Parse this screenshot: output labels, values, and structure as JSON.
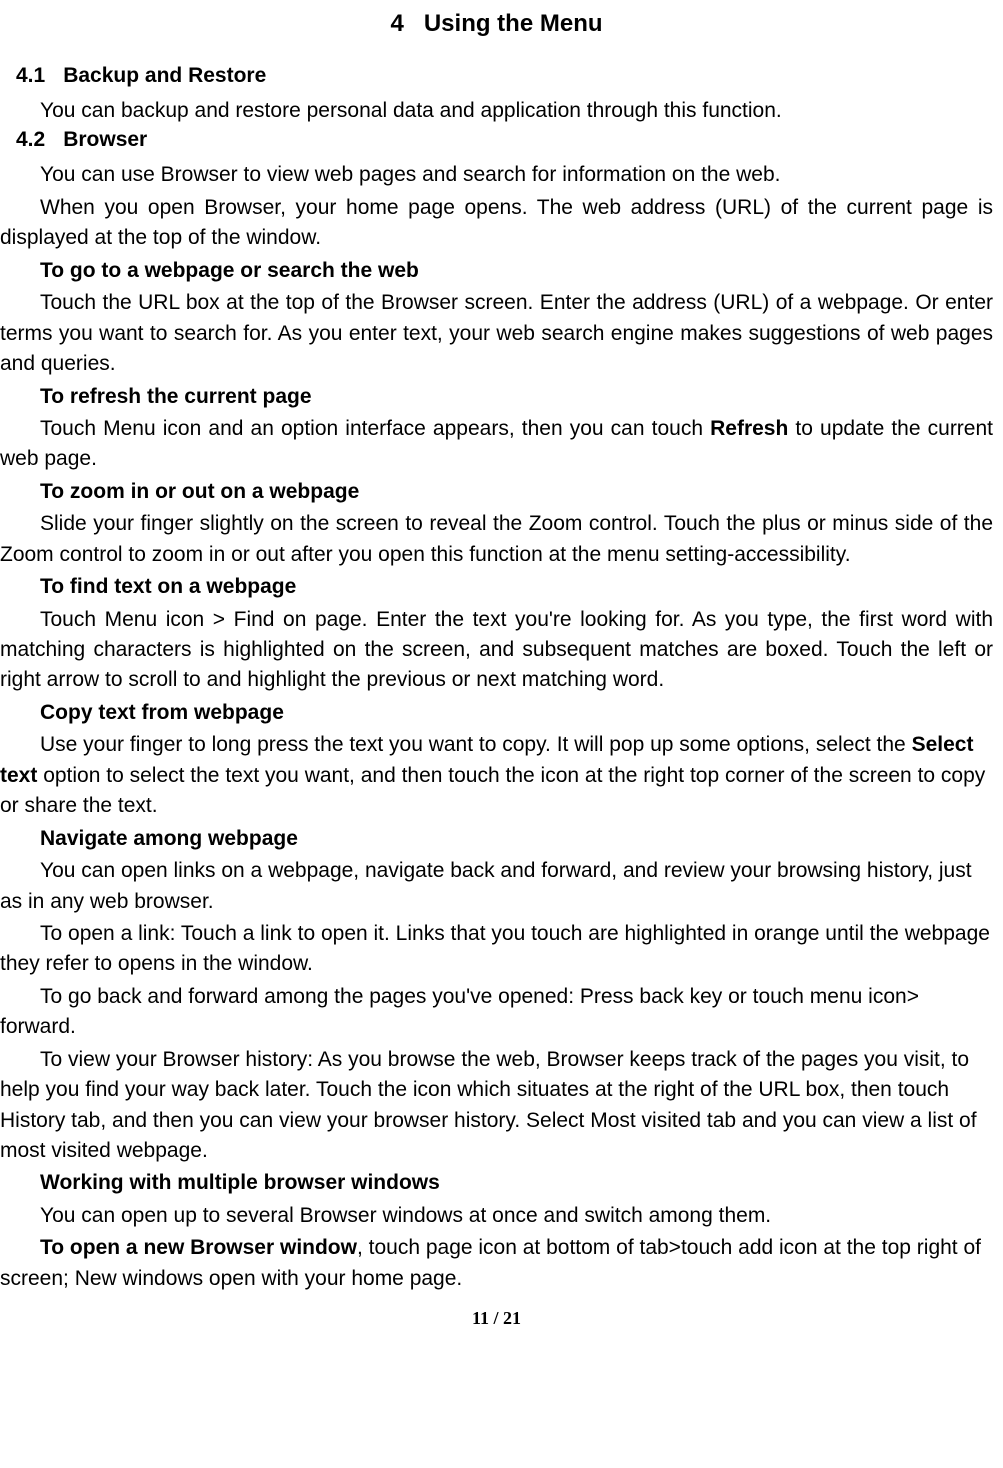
{
  "chapter": {
    "number": "4",
    "title": "Using the Menu"
  },
  "sections": {
    "s41": {
      "number": "4.1",
      "title": "Backup and Restore"
    },
    "s42": {
      "number": "4.2",
      "title": "Browser"
    }
  },
  "body": {
    "backup_para": "You can backup and restore personal data and application through this function.",
    "browser_intro": "You can use Browser to view web pages and search for information on the web.",
    "browser_open": "When you open Browser, your home page opens. The web address (URL) of the current page is displayed at the top of the window.",
    "goto_head": "To go to a webpage or search the web",
    "goto_body": "Touch the URL box at the top of the Browser screen. Enter the address (URL) of a webpage. Or enter terms you want to search for. As you enter text, your web search engine makes suggestions of web pages and queries.",
    "refresh_head": "To refresh the current page",
    "refresh_body_pre": "Touch Menu icon and an option interface appears, then you can touch ",
    "refresh_bold": "Refresh",
    "refresh_body_post": " to update the current web page.",
    "zoom_head": "To zoom in or out on a webpage",
    "zoom_body": "Slide your finger slightly on the screen to reveal the Zoom control. Touch the plus or minus side of the Zoom control to zoom in or out after you open this function at the menu setting-accessibility.",
    "find_head": "To find text on a webpage",
    "find_body": "Touch Menu icon > Find on page. Enter the text you're looking for. As you type, the first word with matching characters is highlighted on the screen, and subsequent matches are boxed. Touch the left or right arrow to scroll to and highlight the previous or next matching word.",
    "copy_head": "Copy text from webpage",
    "copy_body_pre": "Use your finger to long press the text you want to copy. It will pop up some options, select the ",
    "copy_bold": "Select text",
    "copy_body_post": " option to select the text you want, and then touch the icon at the right top corner of the screen to copy or share the text.",
    "nav_head": "Navigate among webpage",
    "nav_body1": "You can open links on a webpage, navigate back and forward, and review your browsing history, just as in any web browser.",
    "nav_body2": "To open a link: Touch a link to open it. Links that you touch are highlighted in orange until the webpage they refer to opens in the window.",
    "nav_body3": "To go back and forward among the pages you've opened: Press back key or touch menu icon> forward.",
    "nav_body4": "To view your Browser history: As you browse the web, Browser keeps track of the pages you visit, to help you find your way back later. Touch the icon which situates at the right of the URL box, then touch History tab, and then you can view your browser history. Select Most visited tab and you can view a list of most visited webpage.",
    "multi_head": "Working with multiple browser windows",
    "multi_body": "You can open up to several Browser windows at once and switch among them.",
    "newwin_head": "To open a new Browser window",
    "newwin_body": ", touch page icon at bottom of tab>touch add icon at the top   right of screen; New windows open with your home page."
  },
  "footer": {
    "page": "11 / 21"
  }
}
